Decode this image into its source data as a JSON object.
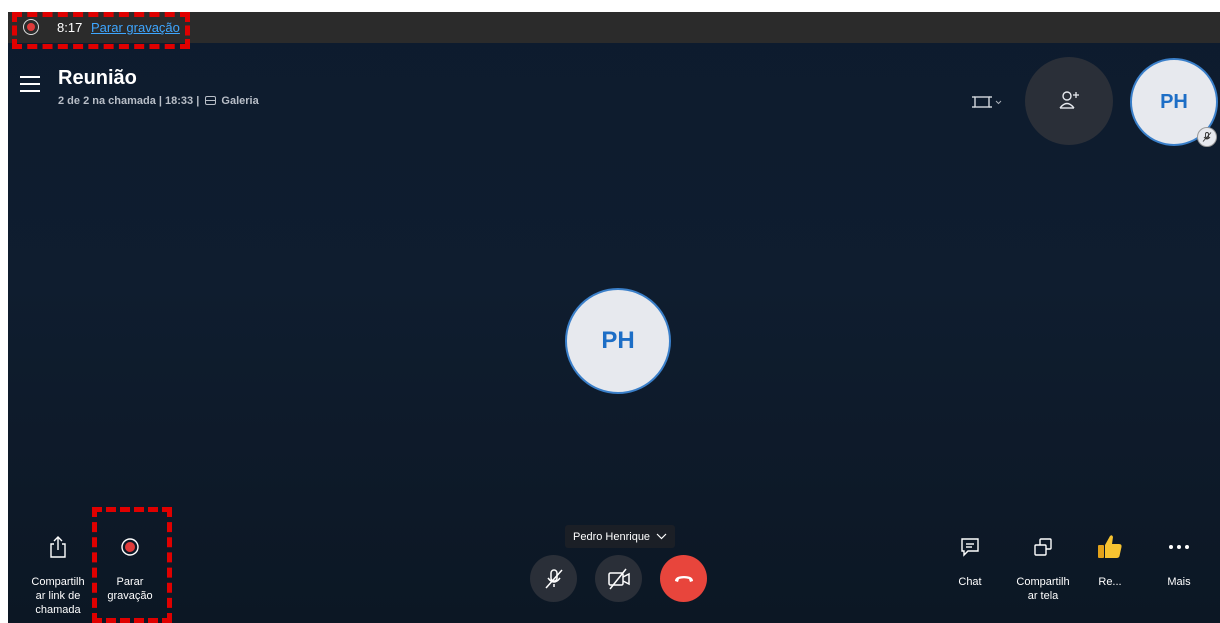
{
  "recording_bar": {
    "elapsed": "8:17",
    "stop_link": "Parar gravação"
  },
  "meeting": {
    "title": "Reunião",
    "subtitle": "2 de 2 na chamada | 18:33  |",
    "view_mode": "Galeria"
  },
  "participant": {
    "initials": "PH",
    "name": "Pedro Henrique"
  },
  "self_view": {
    "initials": "PH"
  },
  "left_tools": [
    {
      "label": "Compartilh\nar link de\nchamada",
      "icon": "share-upload-icon"
    },
    {
      "label": "Parar\ngravação",
      "icon": "record-stop-icon"
    }
  ],
  "right_tools": [
    {
      "label": "Chat",
      "icon": "chat-icon"
    },
    {
      "label": "Compartilh\nar tela",
      "icon": "share-screen-icon"
    },
    {
      "label": "Re...",
      "icon": "thumbs-up-icon"
    },
    {
      "label": "Mais",
      "icon": "more-icon"
    }
  ],
  "colors": {
    "accent": "#1d6ec6",
    "record_red": "#e03b3b",
    "hangup": "#e8453c",
    "link": "#3ea6ff"
  }
}
